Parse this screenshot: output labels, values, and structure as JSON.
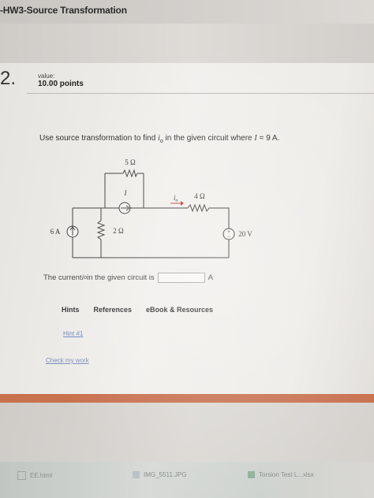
{
  "assignment_title": "-HW3-Source Transformation",
  "question": {
    "number": "2.",
    "value_label": "value:",
    "points": "10.00 points",
    "prompt_before": "Use source transformation to find ",
    "prompt_var_i": "i",
    "prompt_var_sub": "o",
    "prompt_middle": " in the given circuit where ",
    "prompt_var_I": "I",
    "prompt_after": " = 9 A."
  },
  "circuit": {
    "r_top": "5 Ω",
    "r_right": "4 Ω",
    "r_shunt": "2 Ω",
    "src_current_left": "6 A",
    "src_current_mid": "I",
    "src_voltage": "20 V",
    "io_label": "i",
    "io_sub": "o"
  },
  "answer": {
    "prefix": "The current ",
    "var_i": "i",
    "var_sub": "o",
    "middle": " in the given circuit is",
    "value": "",
    "unit": "A"
  },
  "tabs": [
    "Hints",
    "References",
    "eBook & Resources"
  ],
  "hint_link": "Hint #1",
  "check_link": "Check my work",
  "downloads": [
    {
      "name": "EE.html",
      "icon": "html-file-icon"
    },
    {
      "name": "IMG_5511.JPG",
      "icon": "image-file-icon"
    },
    {
      "name": "Torsion Test L...xlsx",
      "icon": "excel-file-icon"
    }
  ],
  "colors": {
    "accent_orange": "#c8714f",
    "link_blue": "#6d87c4"
  }
}
